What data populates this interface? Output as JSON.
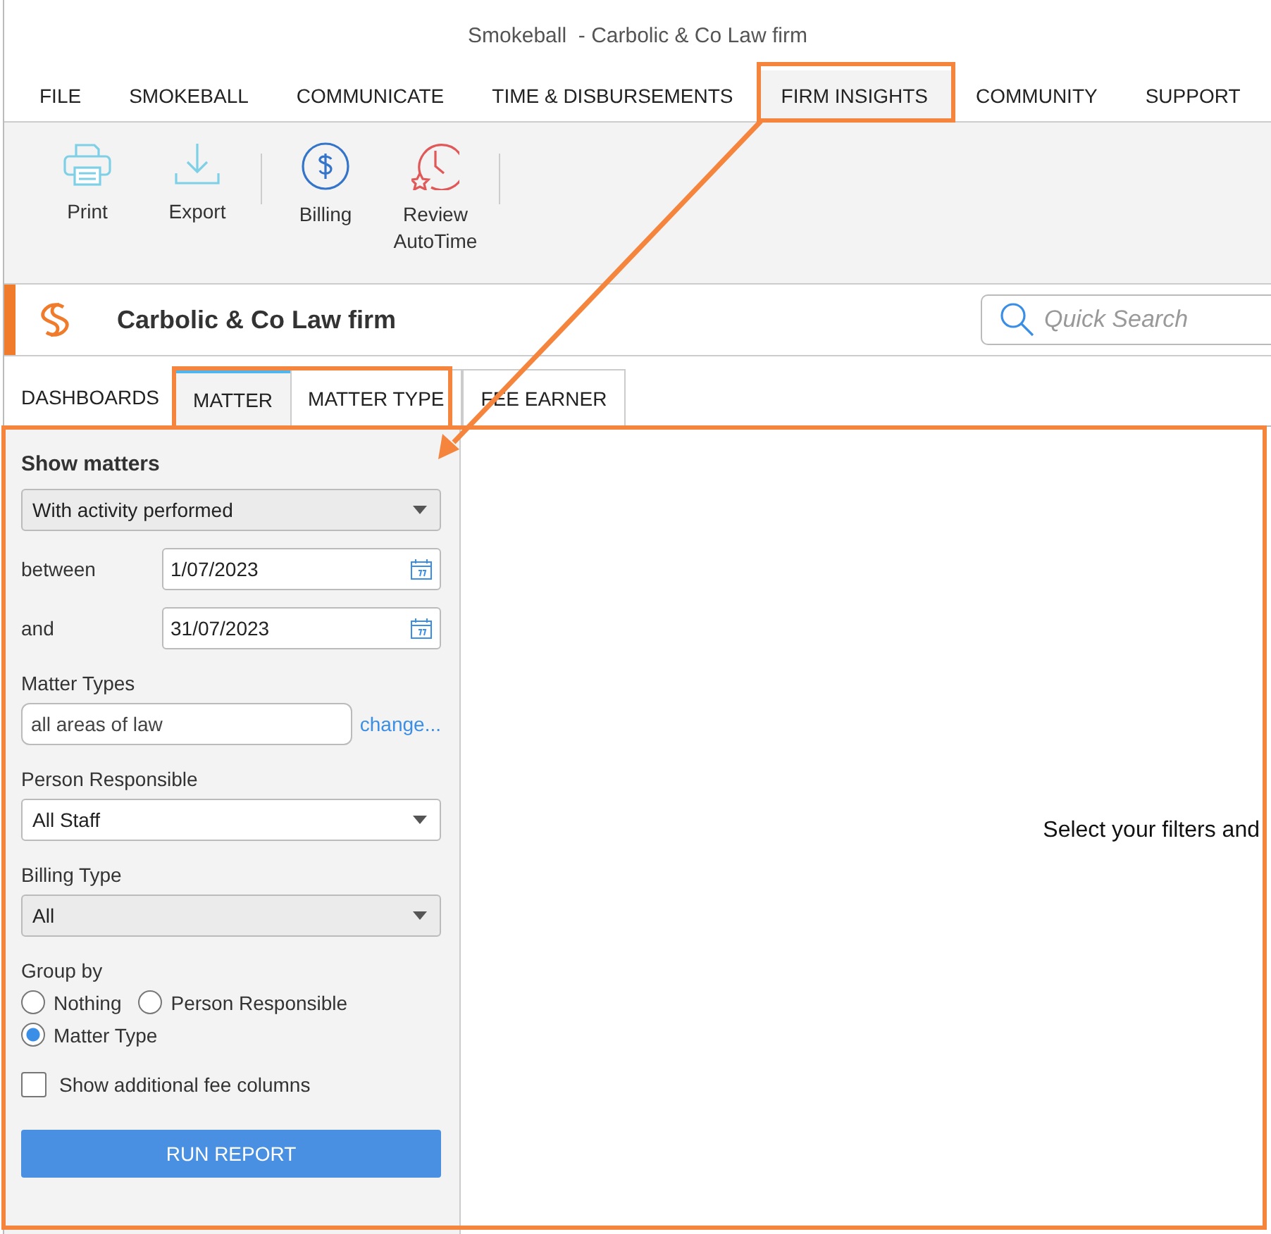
{
  "window": {
    "title": "Smokeball  - Carbolic & Co Law firm"
  },
  "menu": [
    {
      "label": "FILE",
      "selected": false
    },
    {
      "label": "SMOKEBALL",
      "selected": false
    },
    {
      "label": "COMMUNICATE",
      "selected": false
    },
    {
      "label": "TIME & DISBURSEMENTS",
      "selected": false
    },
    {
      "label": "FIRM INSIGHTS",
      "selected": true
    },
    {
      "label": "COMMUNITY",
      "selected": false
    },
    {
      "label": "SUPPORT",
      "selected": false
    }
  ],
  "ribbon_groups": [
    [
      {
        "label": "Print",
        "kind": "print"
      },
      {
        "label": "Export",
        "kind": "export"
      }
    ],
    [
      {
        "label": "Billing",
        "kind": "billing"
      },
      {
        "label": "Review AutoTime",
        "kind": "autotime"
      }
    ]
  ],
  "firm": {
    "name": "Carbolic & Co Law firm"
  },
  "search": {
    "placeholder": "Quick Search"
  },
  "tabs": [
    {
      "label": "DASHBOARDS",
      "selected": false
    },
    {
      "label": "MATTER",
      "selected": true
    },
    {
      "label": "MATTER TYPE",
      "selected": false
    },
    {
      "label": "FEE EARNER",
      "selected": false
    }
  ],
  "filters": {
    "title": "Show matters",
    "show_matters": {
      "value": "With activity performed",
      "shaded": true
    },
    "dates": [
      {
        "label": "between",
        "value": "1/07/2023"
      },
      {
        "label": "and",
        "value": "31/07/2023"
      }
    ],
    "matter_types": {
      "label": "Matter Types",
      "value": "all areas of law",
      "link": "change..."
    },
    "person_responsible": {
      "label": "Person Responsible",
      "value": "All Staff",
      "shaded": false
    },
    "billing_type": {
      "label": "Billing Type",
      "value": "All",
      "shaded": true
    },
    "group_by": {
      "label": "Group by",
      "options": [
        {
          "label": "Nothing",
          "selected": false
        },
        {
          "label": "Person Responsible",
          "selected": false
        },
        {
          "label": "Matter Type",
          "selected": true
        }
      ]
    },
    "additional_fees": {
      "label": "Show additional fee columns",
      "checked": false
    },
    "run_button": "RUN REPORT"
  },
  "message": "Select your filters and"
}
